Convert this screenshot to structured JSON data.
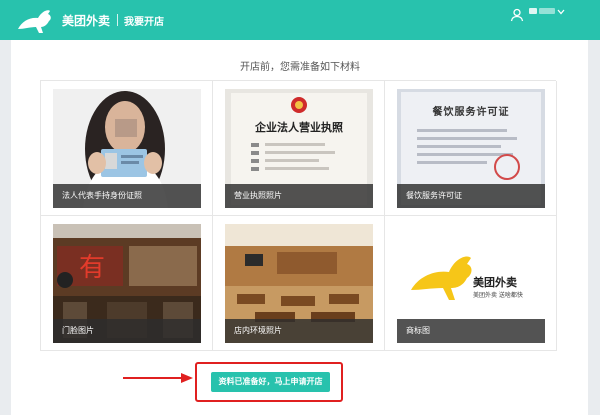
{
  "header": {
    "brand": "美团外卖",
    "subtitle": "我要开店",
    "accent_color": "#28c2ad",
    "logo_icon": "kangaroo-logo",
    "user_icon": "user-icon",
    "menu_icon": "chevron-down-icon"
  },
  "main": {
    "heading": "开店前，您需准备如下材料",
    "materials": [
      {
        "label": "法人代表手持身份证照"
      },
      {
        "label": "营业执照照片",
        "cert_title": "企业法人营业执照"
      },
      {
        "label": "餐饮服务许可证",
        "cert_title": "餐饮服务许可证"
      },
      {
        "label": "门脸图片"
      },
      {
        "label": "店内环境照片"
      },
      {
        "label": "商标图",
        "brand_name": "美团外卖",
        "brand_slogan": "美团外卖 送啥都快"
      }
    ],
    "submit_label": "资料已准备好，马上申请开店"
  }
}
